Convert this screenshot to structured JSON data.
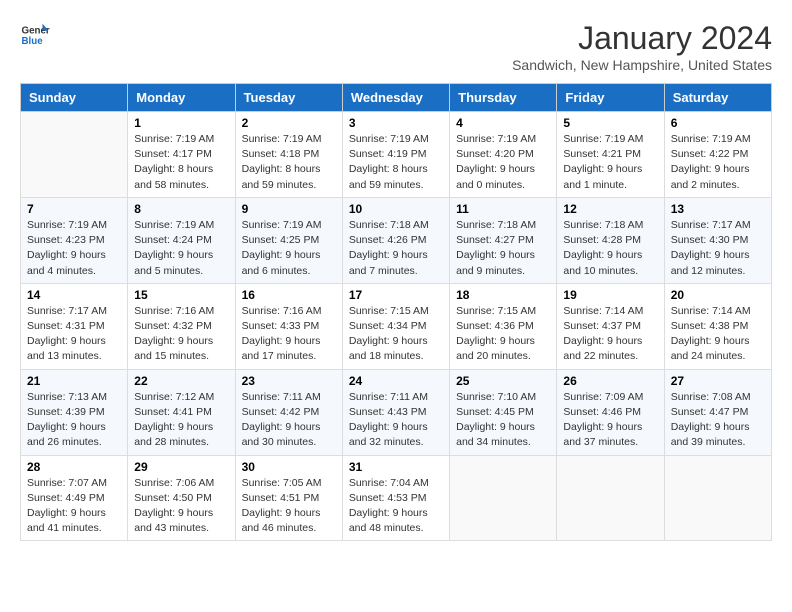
{
  "header": {
    "logo_line1": "General",
    "logo_line2": "Blue",
    "month_title": "January 2024",
    "location": "Sandwich, New Hampshire, United States"
  },
  "days_of_week": [
    "Sunday",
    "Monday",
    "Tuesday",
    "Wednesday",
    "Thursday",
    "Friday",
    "Saturday"
  ],
  "weeks": [
    [
      {
        "day": "",
        "sunrise": "",
        "sunset": "",
        "daylight": ""
      },
      {
        "day": "1",
        "sunrise": "Sunrise: 7:19 AM",
        "sunset": "Sunset: 4:17 PM",
        "daylight": "Daylight: 8 hours and 58 minutes."
      },
      {
        "day": "2",
        "sunrise": "Sunrise: 7:19 AM",
        "sunset": "Sunset: 4:18 PM",
        "daylight": "Daylight: 8 hours and 59 minutes."
      },
      {
        "day": "3",
        "sunrise": "Sunrise: 7:19 AM",
        "sunset": "Sunset: 4:19 PM",
        "daylight": "Daylight: 8 hours and 59 minutes."
      },
      {
        "day": "4",
        "sunrise": "Sunrise: 7:19 AM",
        "sunset": "Sunset: 4:20 PM",
        "daylight": "Daylight: 9 hours and 0 minutes."
      },
      {
        "day": "5",
        "sunrise": "Sunrise: 7:19 AM",
        "sunset": "Sunset: 4:21 PM",
        "daylight": "Daylight: 9 hours and 1 minute."
      },
      {
        "day": "6",
        "sunrise": "Sunrise: 7:19 AM",
        "sunset": "Sunset: 4:22 PM",
        "daylight": "Daylight: 9 hours and 2 minutes."
      }
    ],
    [
      {
        "day": "7",
        "sunrise": "Sunrise: 7:19 AM",
        "sunset": "Sunset: 4:23 PM",
        "daylight": "Daylight: 9 hours and 4 minutes."
      },
      {
        "day": "8",
        "sunrise": "Sunrise: 7:19 AM",
        "sunset": "Sunset: 4:24 PM",
        "daylight": "Daylight: 9 hours and 5 minutes."
      },
      {
        "day": "9",
        "sunrise": "Sunrise: 7:19 AM",
        "sunset": "Sunset: 4:25 PM",
        "daylight": "Daylight: 9 hours and 6 minutes."
      },
      {
        "day": "10",
        "sunrise": "Sunrise: 7:18 AM",
        "sunset": "Sunset: 4:26 PM",
        "daylight": "Daylight: 9 hours and 7 minutes."
      },
      {
        "day": "11",
        "sunrise": "Sunrise: 7:18 AM",
        "sunset": "Sunset: 4:27 PM",
        "daylight": "Daylight: 9 hours and 9 minutes."
      },
      {
        "day": "12",
        "sunrise": "Sunrise: 7:18 AM",
        "sunset": "Sunset: 4:28 PM",
        "daylight": "Daylight: 9 hours and 10 minutes."
      },
      {
        "day": "13",
        "sunrise": "Sunrise: 7:17 AM",
        "sunset": "Sunset: 4:30 PM",
        "daylight": "Daylight: 9 hours and 12 minutes."
      }
    ],
    [
      {
        "day": "14",
        "sunrise": "Sunrise: 7:17 AM",
        "sunset": "Sunset: 4:31 PM",
        "daylight": "Daylight: 9 hours and 13 minutes."
      },
      {
        "day": "15",
        "sunrise": "Sunrise: 7:16 AM",
        "sunset": "Sunset: 4:32 PM",
        "daylight": "Daylight: 9 hours and 15 minutes."
      },
      {
        "day": "16",
        "sunrise": "Sunrise: 7:16 AM",
        "sunset": "Sunset: 4:33 PM",
        "daylight": "Daylight: 9 hours and 17 minutes."
      },
      {
        "day": "17",
        "sunrise": "Sunrise: 7:15 AM",
        "sunset": "Sunset: 4:34 PM",
        "daylight": "Daylight: 9 hours and 18 minutes."
      },
      {
        "day": "18",
        "sunrise": "Sunrise: 7:15 AM",
        "sunset": "Sunset: 4:36 PM",
        "daylight": "Daylight: 9 hours and 20 minutes."
      },
      {
        "day": "19",
        "sunrise": "Sunrise: 7:14 AM",
        "sunset": "Sunset: 4:37 PM",
        "daylight": "Daylight: 9 hours and 22 minutes."
      },
      {
        "day": "20",
        "sunrise": "Sunrise: 7:14 AM",
        "sunset": "Sunset: 4:38 PM",
        "daylight": "Daylight: 9 hours and 24 minutes."
      }
    ],
    [
      {
        "day": "21",
        "sunrise": "Sunrise: 7:13 AM",
        "sunset": "Sunset: 4:39 PM",
        "daylight": "Daylight: 9 hours and 26 minutes."
      },
      {
        "day": "22",
        "sunrise": "Sunrise: 7:12 AM",
        "sunset": "Sunset: 4:41 PM",
        "daylight": "Daylight: 9 hours and 28 minutes."
      },
      {
        "day": "23",
        "sunrise": "Sunrise: 7:11 AM",
        "sunset": "Sunset: 4:42 PM",
        "daylight": "Daylight: 9 hours and 30 minutes."
      },
      {
        "day": "24",
        "sunrise": "Sunrise: 7:11 AM",
        "sunset": "Sunset: 4:43 PM",
        "daylight": "Daylight: 9 hours and 32 minutes."
      },
      {
        "day": "25",
        "sunrise": "Sunrise: 7:10 AM",
        "sunset": "Sunset: 4:45 PM",
        "daylight": "Daylight: 9 hours and 34 minutes."
      },
      {
        "day": "26",
        "sunrise": "Sunrise: 7:09 AM",
        "sunset": "Sunset: 4:46 PM",
        "daylight": "Daylight: 9 hours and 37 minutes."
      },
      {
        "day": "27",
        "sunrise": "Sunrise: 7:08 AM",
        "sunset": "Sunset: 4:47 PM",
        "daylight": "Daylight: 9 hours and 39 minutes."
      }
    ],
    [
      {
        "day": "28",
        "sunrise": "Sunrise: 7:07 AM",
        "sunset": "Sunset: 4:49 PM",
        "daylight": "Daylight: 9 hours and 41 minutes."
      },
      {
        "day": "29",
        "sunrise": "Sunrise: 7:06 AM",
        "sunset": "Sunset: 4:50 PM",
        "daylight": "Daylight: 9 hours and 43 minutes."
      },
      {
        "day": "30",
        "sunrise": "Sunrise: 7:05 AM",
        "sunset": "Sunset: 4:51 PM",
        "daylight": "Daylight: 9 hours and 46 minutes."
      },
      {
        "day": "31",
        "sunrise": "Sunrise: 7:04 AM",
        "sunset": "Sunset: 4:53 PM",
        "daylight": "Daylight: 9 hours and 48 minutes."
      },
      {
        "day": "",
        "sunrise": "",
        "sunset": "",
        "daylight": ""
      },
      {
        "day": "",
        "sunrise": "",
        "sunset": "",
        "daylight": ""
      },
      {
        "day": "",
        "sunrise": "",
        "sunset": "",
        "daylight": ""
      }
    ]
  ]
}
